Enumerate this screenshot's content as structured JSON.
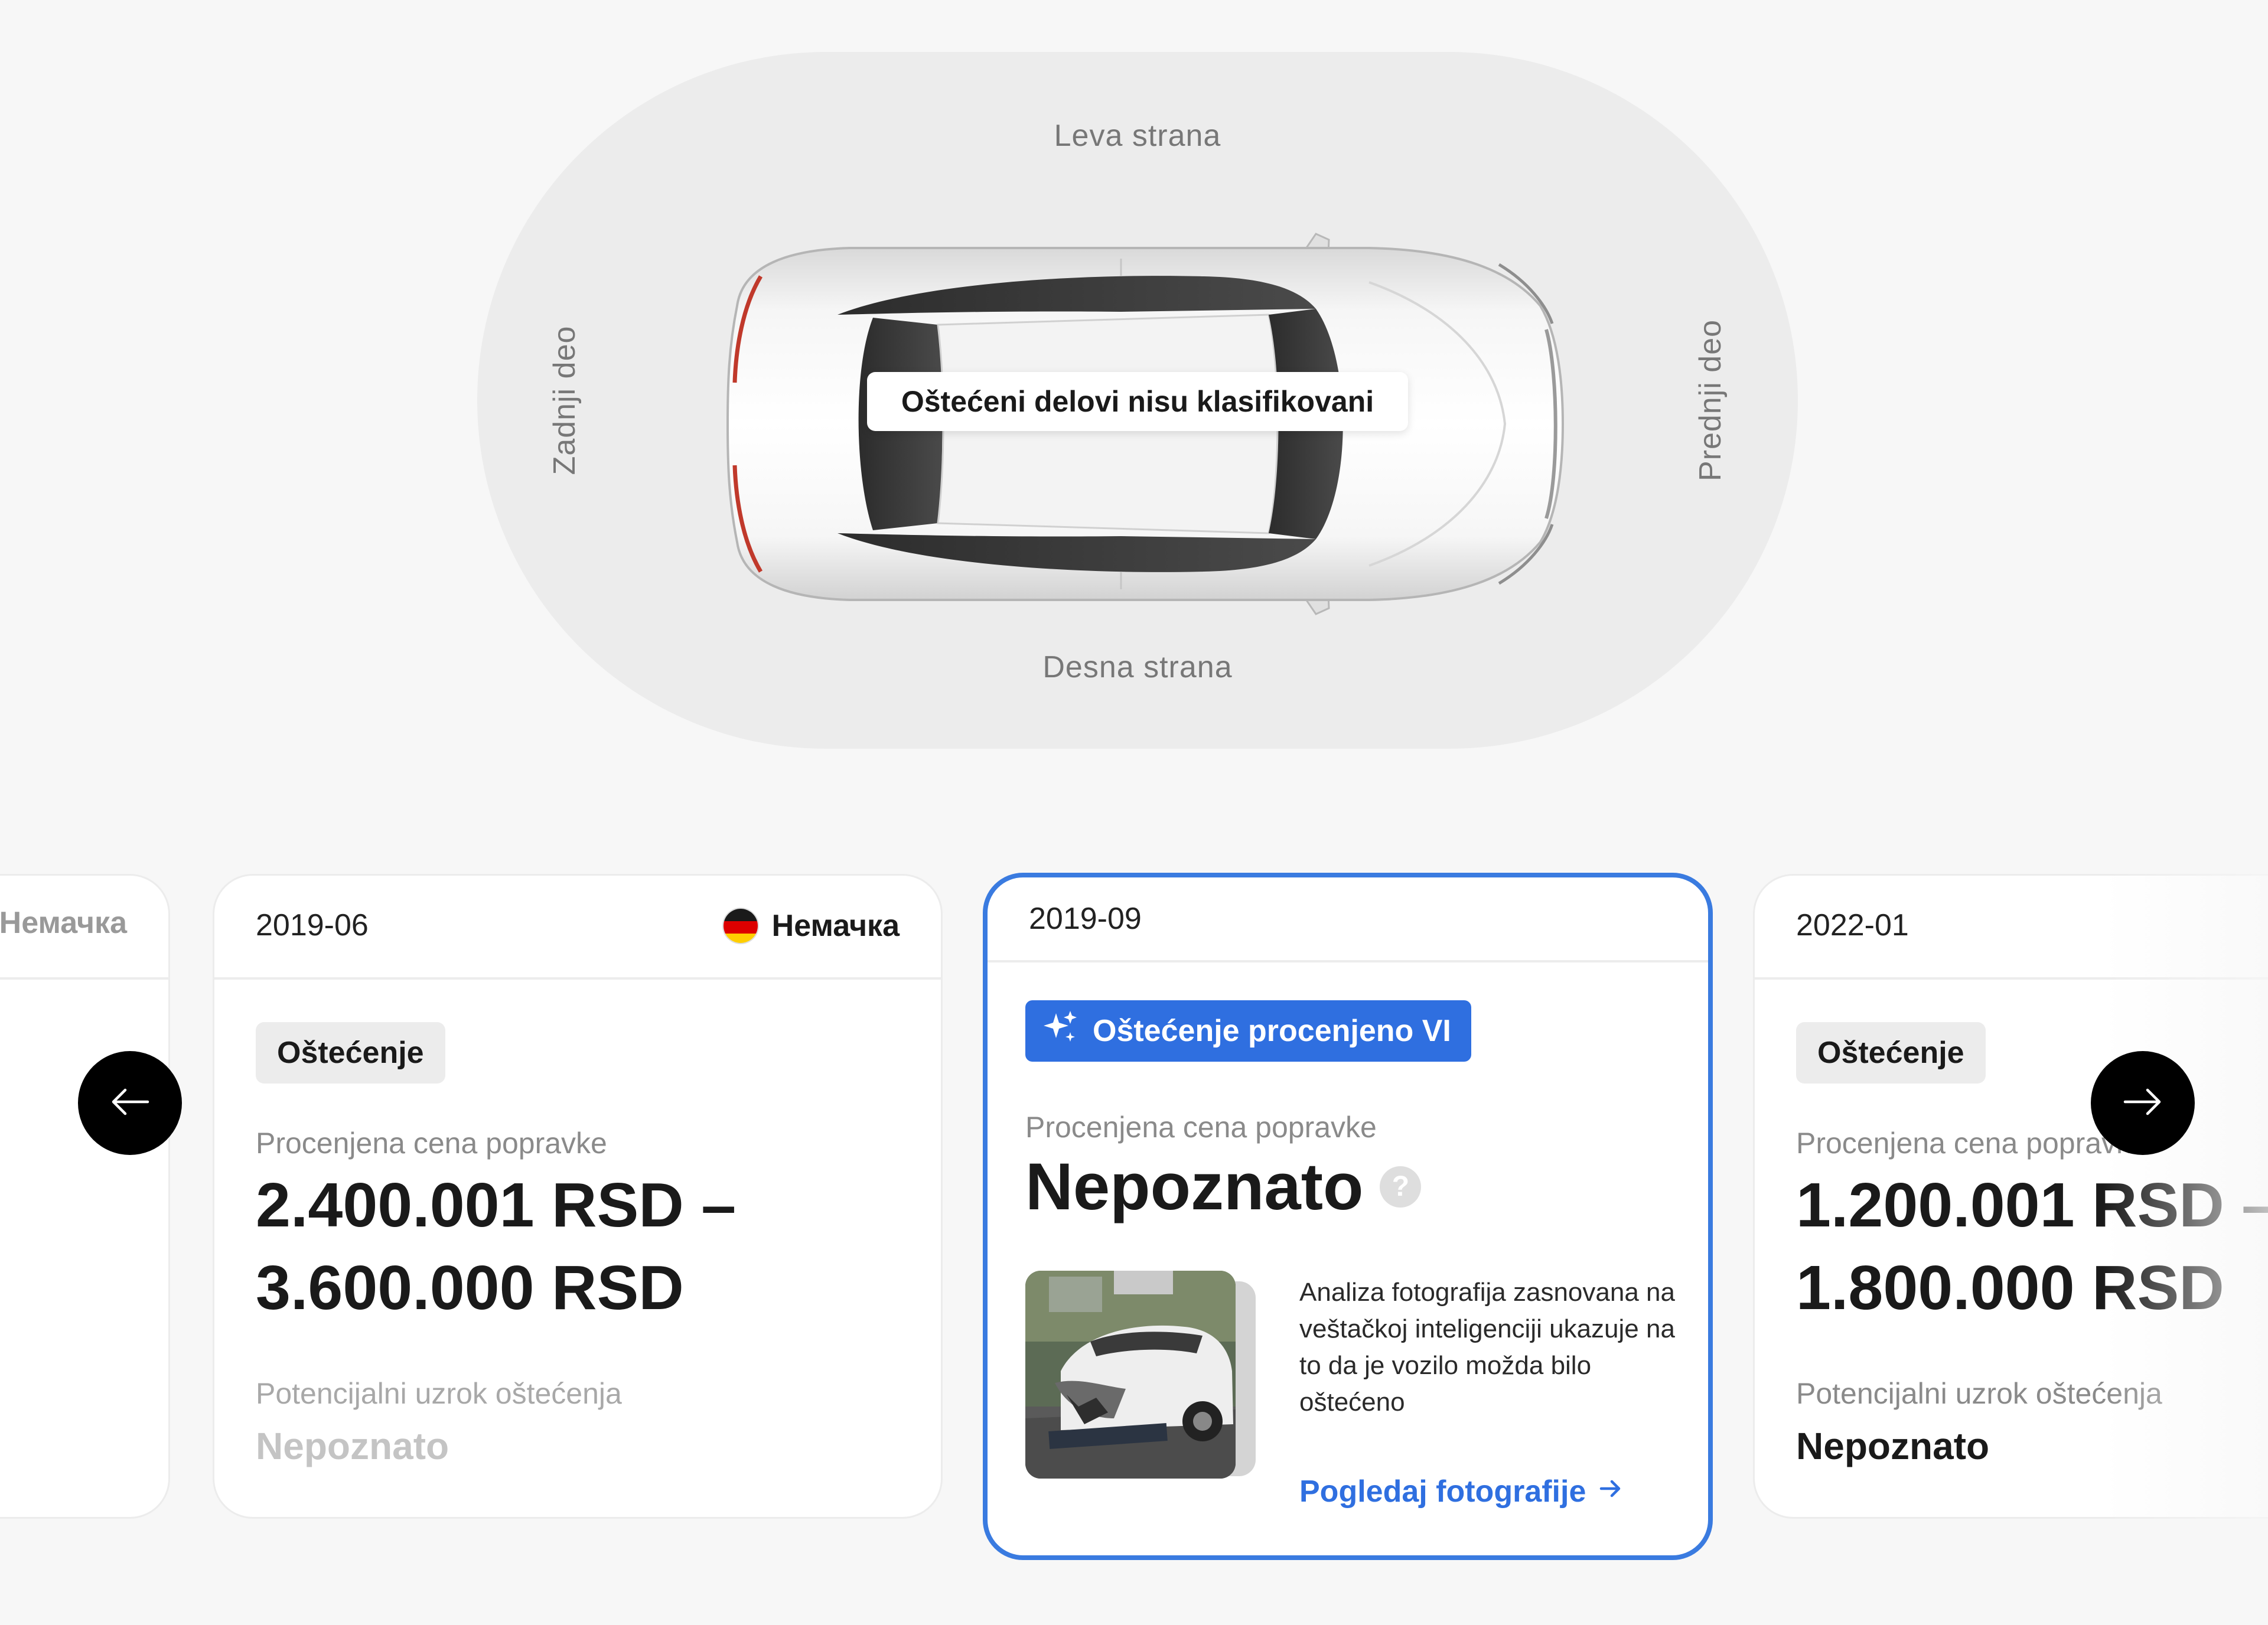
{
  "diagram": {
    "left_side": "Leva strana",
    "right_side": "Desna strana",
    "rear": "Zadnji deo",
    "front": "Prednji deo",
    "badge": "Oštećeni delovi nisu klasifikovani"
  },
  "cards": [
    {
      "country": "Немачка"
    },
    {
      "date": "2019-06",
      "country": "Немачка",
      "tag": "Oštećenje",
      "price_label": "Procenjena cena popravke",
      "price_line1": "2.400.001 RSD –",
      "price_line2": "3.600.000 RSD",
      "cause_label": "Potencijalni uzrok oštećenja",
      "cause_value": "Nepoznato"
    },
    {
      "date": "2019-09",
      "tag": "Oštećenje procenjeno VI",
      "price_label": "Procenjena cena popravke",
      "price_value": "Nepoznato",
      "help_mark": "?",
      "description": "Analiza fotografija zasnovana na veštačkoj inteligenciji ukazuje na to da je vozilo možda bilo oštećeno",
      "link": "Pogledaj fotografije"
    },
    {
      "date": "2022-01",
      "tag": "Oštećenje",
      "price_label": "Procenjena cena popravke",
      "price_line1": "1.200.001 RSD –",
      "price_line2": "1.800.000 RSD",
      "cause_label": "Potencijalni uzrok oštećenja",
      "cause_value": "Nepoznato"
    }
  ],
  "colors": {
    "accent": "#2f6fe0",
    "active_border": "#3a7be0",
    "background": "#f7f7f7",
    "diagram_bg": "#ececec"
  },
  "icons": {
    "prev": "arrow-left-icon",
    "next": "arrow-right-icon",
    "ai": "sparkles-icon",
    "link": "arrow-right-icon",
    "help": "question-icon",
    "flag": "germany-flag-icon"
  }
}
